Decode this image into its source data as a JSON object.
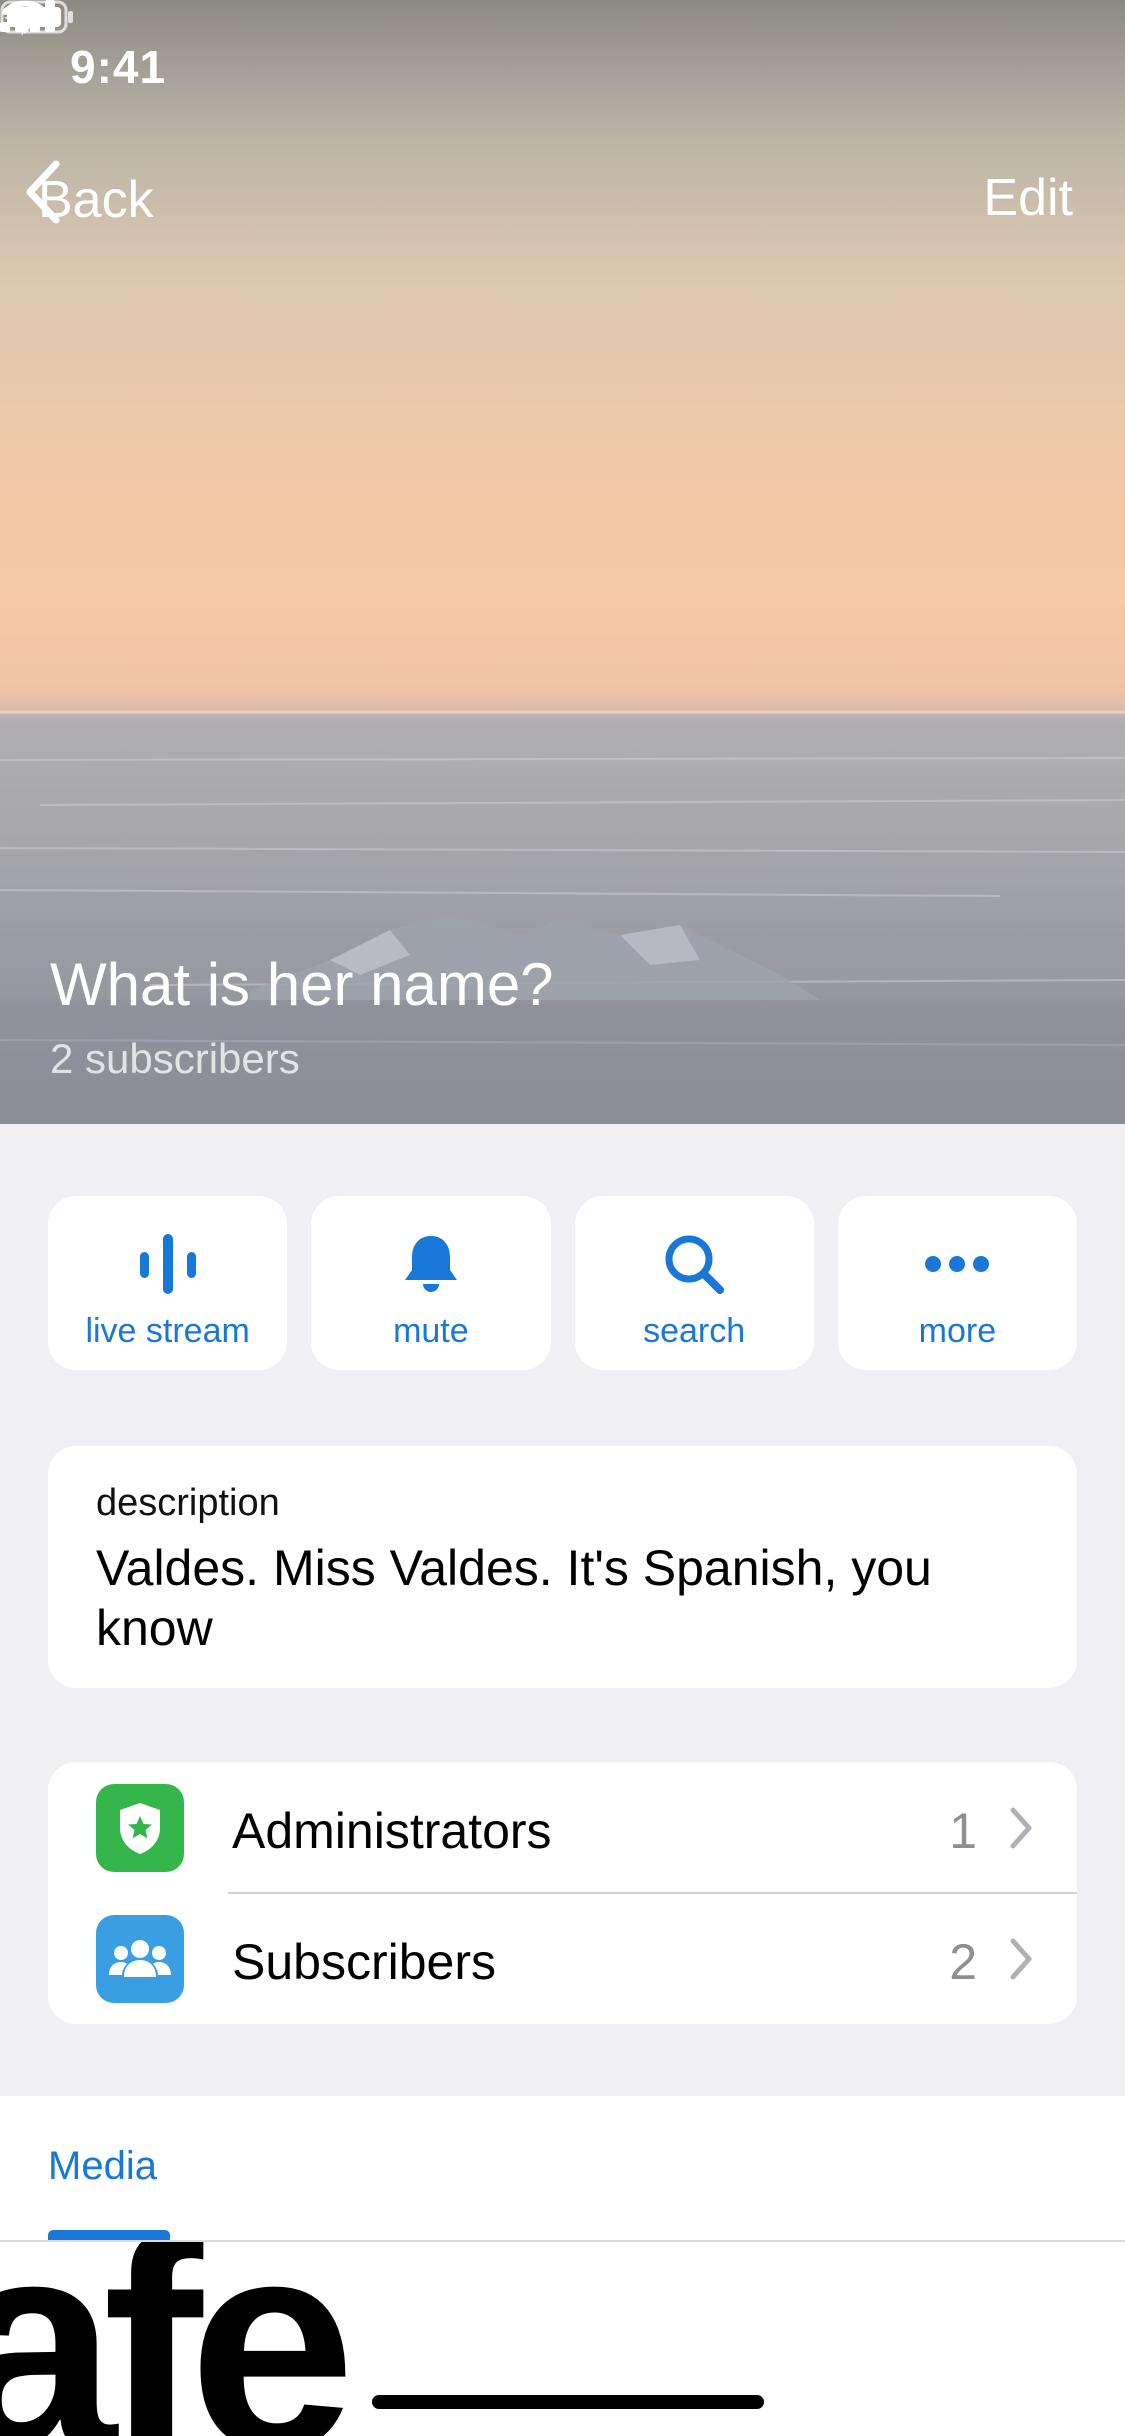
{
  "status_bar": {
    "time": "9:41"
  },
  "nav": {
    "back_label": "Back",
    "edit_label": "Edit"
  },
  "channel": {
    "title": "What is her name?",
    "subscribers": "2 subscribers"
  },
  "actions": [
    {
      "label": "live stream",
      "icon": "live-stream-icon"
    },
    {
      "label": "mute",
      "icon": "bell-icon"
    },
    {
      "label": "search",
      "icon": "search-icon"
    },
    {
      "label": "more",
      "icon": "more-dots-icon"
    }
  ],
  "description": {
    "label": "description",
    "text": "Valdes. Miss Valdes. It's Spanish, you know"
  },
  "list": [
    {
      "label": "Administrators",
      "count": "1",
      "icon": "admin-shield-icon",
      "color": "#34b64b"
    },
    {
      "label": "Subscribers",
      "count": "2",
      "icon": "people-icon",
      "color": "#3a9ee2"
    }
  ],
  "media": {
    "tab_label": "Media",
    "thumb_text": "afe"
  },
  "colors": {
    "accent": "#1877d7",
    "background": "#efeff4"
  }
}
